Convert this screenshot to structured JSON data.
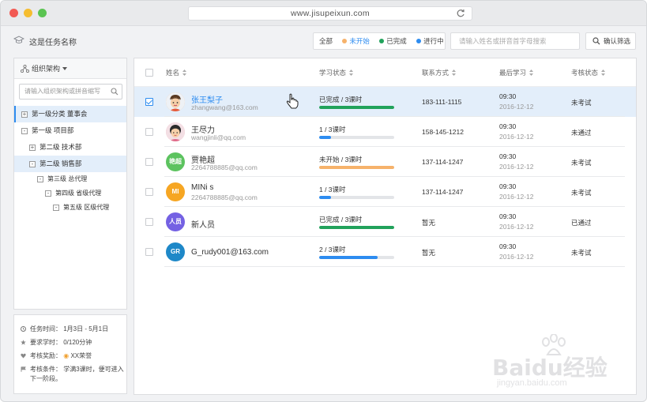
{
  "browser": {
    "url": "www.jisupeixun.com"
  },
  "header": {
    "task_name": "这是任务名称",
    "filters": [
      {
        "label": "全部",
        "color": ""
      },
      {
        "label": "未开始",
        "color": "#f6b26b"
      },
      {
        "label": "已完成",
        "color": "#21a25b"
      },
      {
        "label": "进行中",
        "color": "#2d8cf0"
      }
    ],
    "search_placeholder": "请输入姓名或拼音首字母搜索",
    "confirm_label": "确认筛选"
  },
  "sidebar": {
    "title": "组织架构",
    "search_placeholder": "请输入组织架构或拼音缩写",
    "tree": [
      {
        "toggle": "+",
        "label": "第一级分类 董事会"
      },
      {
        "toggle": "-",
        "label": "第一级 项目部"
      },
      {
        "toggle": "+",
        "label": "第二级 技术部"
      },
      {
        "toggle": "-",
        "label": "第二级 销售部"
      },
      {
        "toggle": "-",
        "label": "第三级 总代理"
      },
      {
        "toggle": "-",
        "label": "第四级 省级代理"
      },
      {
        "toggle": "-",
        "label": "第五级 区级代理"
      }
    ]
  },
  "info": {
    "time": "任务时间： 1月3日 - 5月1日",
    "hours": "要求学时： 0/120分钟",
    "reward_label": "考核奖励：",
    "reward_value": "XX荣誉",
    "condition": "考核条件： 学满3课时，便可进入下一阶段。"
  },
  "table": {
    "headers": {
      "name": "姓名",
      "status": "学习状态",
      "contact": "联系方式",
      "last": "最后学习",
      "exam": "考核状态"
    },
    "rows": [
      {
        "name": "张王梨子",
        "email": "zhangwang@163.com",
        "avatar_text": "",
        "avatar_color": "#f4c7a1",
        "status": "已完成 / 3课时",
        "progress": 1.0,
        "bar_color": "#21a25b",
        "phone": "183-111-1115",
        "time": "09:30",
        "date": "2016-12-12",
        "exam": "未考试",
        "checked": true
      },
      {
        "name": "王尽力",
        "email": "wangjinli@qq.com",
        "avatar_text": "",
        "avatar_color": "#f2b9c4",
        "status": "1 / 3课时",
        "progress": 0.16,
        "bar_color": "#2d8cf0",
        "phone": "158-145-1212",
        "time": "09:30",
        "date": "2016-12-12",
        "exam": "未通过",
        "checked": false
      },
      {
        "name": "贾艳超",
        "email": "2264788885@qq.com",
        "avatar_text": "艳超",
        "avatar_color": "#5cc35f",
        "status": "未开始 / 3课时",
        "progress": 1.0,
        "bar_color": "#f6b26b",
        "phone": "137-114-1247",
        "time": "09:30",
        "date": "2016-12-12",
        "exam": "未考试",
        "checked": false
      },
      {
        "name": "MINi s",
        "email": "2264788885@qq.com",
        "avatar_text": "MI",
        "avatar_color": "#f6a623",
        "status": "1 / 3课时",
        "progress": 0.16,
        "bar_color": "#2d8cf0",
        "phone": "137-114-1247",
        "time": "09:30",
        "date": "2016-12-12",
        "exam": "未考试",
        "checked": false
      },
      {
        "name": "新人员",
        "email": "",
        "avatar_text": "人员",
        "avatar_color": "#7461e3",
        "status": "已完成 / 3课时",
        "progress": 1.0,
        "bar_color": "#21a25b",
        "phone": "暂无",
        "time": "09:30",
        "date": "2016-12-12",
        "exam": "已通过",
        "checked": false
      },
      {
        "name": "G_rudy001@163.com",
        "email": "",
        "avatar_text": "GR",
        "avatar_color": "#1e88c8",
        "status": "2 / 3课时",
        "progress": 0.78,
        "bar_color": "#2d8cf0",
        "phone": "暂无",
        "time": "09:30",
        "date": "2016-12-12",
        "exam": "未考试",
        "checked": false
      }
    ]
  },
  "watermark": {
    "brand": "Baidu经验",
    "domain": "jingyan.baidu.com"
  }
}
